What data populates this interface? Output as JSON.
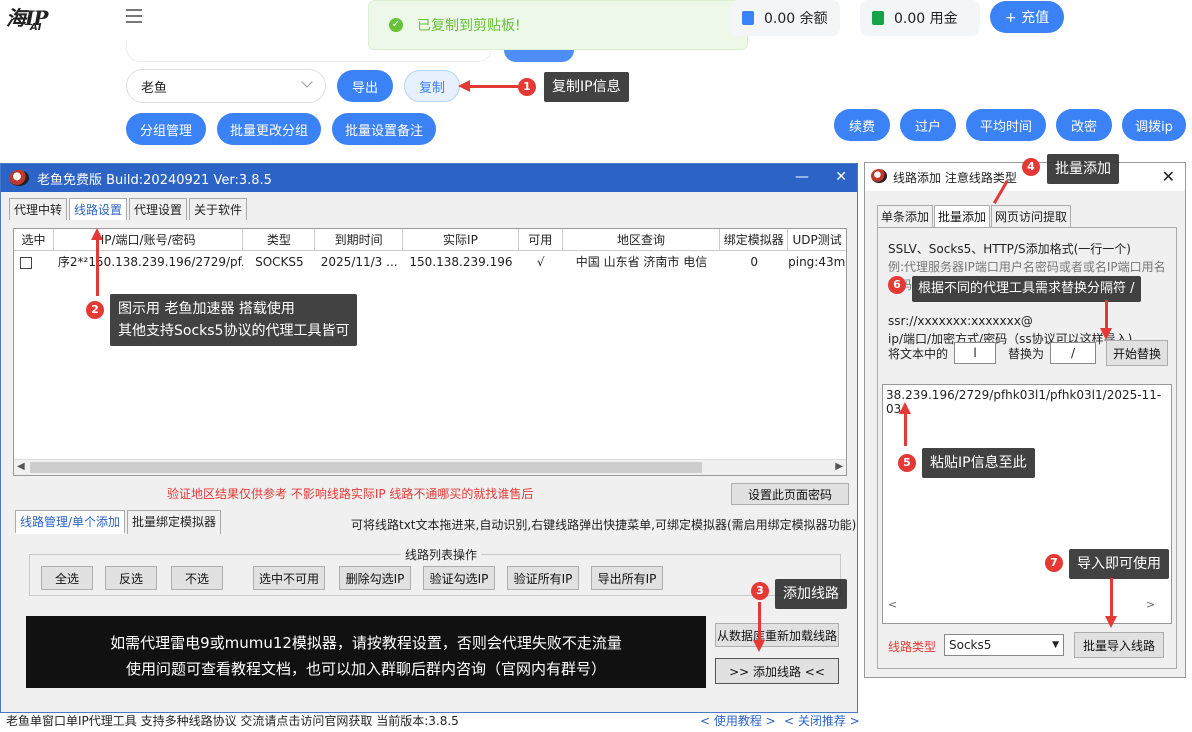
{
  "app": {
    "logo": "海IP",
    "logo_sub": "AI"
  },
  "toast": {
    "message": "已复制到剪贴板!"
  },
  "balance": {
    "balance_label": "0.00 余额",
    "commission_label": "0.00 用金",
    "recharge_label": "+ 充值"
  },
  "toolbar": {
    "select_value": "老鱼",
    "export_label": "导出",
    "copy_label": "复制",
    "group_manage_label": "分组管理",
    "batch_group_label": "批量更改分组",
    "batch_note_label": "批量设置备注",
    "right_buttons": [
      "续费",
      "过户",
      "平均时间",
      "改密",
      "调拨ip"
    ]
  },
  "annotations": {
    "a1": {
      "num": "1",
      "text": "复制IP信息"
    },
    "a2": {
      "num": "2",
      "line1": "图示用 老鱼加速器 搭载使用",
      "line2": "其他支持Socks5协议的代理工具皆可"
    },
    "a3": {
      "num": "3",
      "text": "添加线路"
    },
    "a4": {
      "num": "4",
      "text": "批量添加"
    },
    "a5": {
      "num": "5",
      "text": "粘贴IP信息至此"
    },
    "a6": {
      "num": "6",
      "text": "根据不同的代理工具需求替换分隔符 /"
    },
    "a7": {
      "num": "7",
      "text": "导入即可使用"
    }
  },
  "window": {
    "title": "老鱼免费版 Build:20240921 Ver:3.8.5",
    "minimize": "—",
    "close": "✕",
    "tabs": [
      "代理中转",
      "线路设置",
      "代理设置",
      "关于软件"
    ],
    "active_tab": "线路设置",
    "table": {
      "headers": [
        "选中",
        "IP/端口/账号/密码",
        "类型",
        "到期时间",
        "实际IP",
        "可用",
        "地区查询",
        "绑定模拟器",
        "UDP测试"
      ],
      "rows": [
        {
          "seq": "序2*²",
          "ip": "150.138.239.196/2729/pf...",
          "type": "SOCKS5",
          "expire": "2025/11/3 ...",
          "real_ip": "150.138.239.196",
          "ok": "√",
          "region": "中国 山东省 济南市 电信",
          "emulator": "0",
          "udp": "ping:43m"
        }
      ]
    },
    "warning": "验证地区结果仅供参考 不影响线路实际IP 线路不通哪买的就找谁售后",
    "set_password_label": "设置此页面密码",
    "subtabs": [
      "线路管理/单个添加",
      "批量绑定模拟器"
    ],
    "hint": "可将线路txt文本拖进来,自动识别,右键线路弹出快捷菜单,可绑定模拟器(需启用绑定模拟器功能)",
    "group_title": "线路列表操作",
    "ops": [
      "全选",
      "反选",
      "不选",
      "选中不可用",
      "删除勾选IP",
      "验证勾选IP",
      "验证所有IP",
      "导出所有IP"
    ],
    "notice_line1": "如需代理雷电9或mumu12模拟器，请按教程设置，否则会代理失败不走流量",
    "notice_line2": "使用问题可查看教程文档，也可以加入群聊后群内咨询（官网内有群号）",
    "reload_label": "从数据库重新加载线路",
    "add_line_label": ">>  添加线路  <<"
  },
  "statusbar": {
    "text": "老鱼单窗口单IP代理工具 支持多种线路协议 交流请点击访问官网获取  当前版本:3.8.5",
    "link1": "< 使用教程 >",
    "link2": "< 关闭推荐 >"
  },
  "dialog": {
    "title": "线路添加 注意线路类型",
    "close": "✕",
    "tabs": [
      "单条添加",
      "批量添加",
      "网页访问提取"
    ],
    "active_tab": "批量添加",
    "format_line1": "SSLV、Socks5、HTTP/S添加格式(一行一个)",
    "format_line2": "例:代理服务器IP端口用户名密码或者或名IP端口用名密码",
    "format_line3": "ssr://xxxxxxx:xxxxxxx@",
    "format_line4": "ip/端口/加密方式/密码（ss协议可以这样导入)",
    "replace_label": "将文本中的",
    "replace_from": "l",
    "replace_as": "替换为",
    "replace_to": "/",
    "replace_btn": "开始替换",
    "text_content": "38.239.196/2729/pfhk03l1/pfhk03l1/2025-11-03",
    "line_type_label": "线路类型",
    "line_type_value": "Socks5",
    "import_btn": "批量导入线路"
  },
  "colors": {
    "accent": "#3b82f6",
    "title_bar": "#2b63c6",
    "annotation_red": "#e53935",
    "toast_green": "#67c23a"
  }
}
